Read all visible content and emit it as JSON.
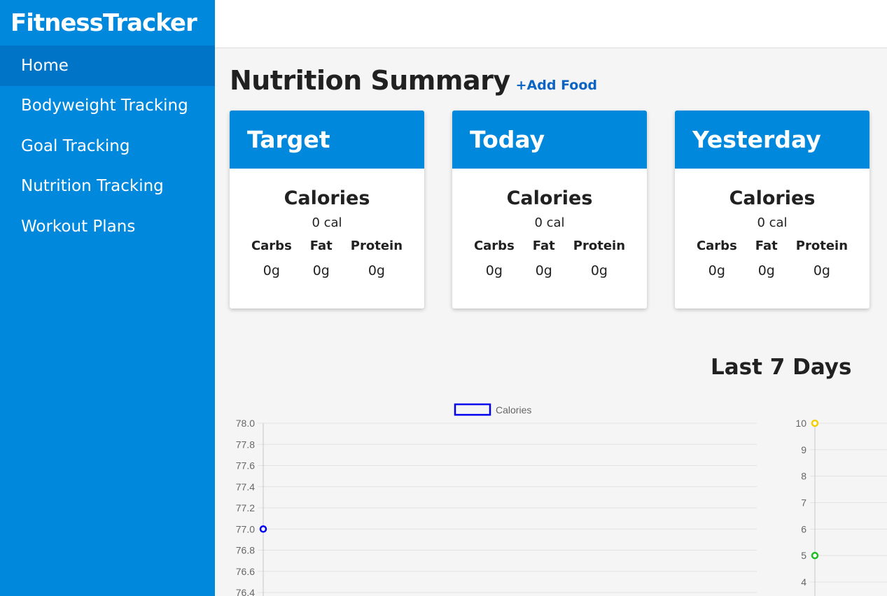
{
  "app": {
    "title": "FitnessTracker"
  },
  "sidebar": {
    "items": [
      {
        "label": "Home",
        "active": true
      },
      {
        "label": "Bodyweight Tracking",
        "active": false
      },
      {
        "label": "Goal Tracking",
        "active": false
      },
      {
        "label": "Nutrition Tracking",
        "active": false
      },
      {
        "label": "Workout Plans",
        "active": false
      }
    ]
  },
  "main": {
    "title": "Nutrition Summary",
    "add_food_label": "+Add Food",
    "cards": [
      {
        "title": "Target",
        "calories_label": "Calories",
        "calories_value": "0 cal",
        "carbs_label": "Carbs",
        "fat_label": "Fat",
        "protein_label": "Protein",
        "carbs": "0g",
        "fat": "0g",
        "protein": "0g"
      },
      {
        "title": "Today",
        "calories_label": "Calories",
        "calories_value": "0 cal",
        "carbs_label": "Carbs",
        "fat_label": "Fat",
        "protein_label": "Protein",
        "carbs": "0g",
        "fat": "0g",
        "protein": "0g"
      },
      {
        "title": "Yesterday",
        "calories_label": "Calories",
        "calories_value": "0 cal",
        "carbs_label": "Carbs",
        "fat_label": "Fat",
        "protein_label": "Protein",
        "carbs": "0g",
        "fat": "0g",
        "protein": "0g"
      }
    ],
    "section_title": "Last 7 Days"
  },
  "colors": {
    "sidebar": "#0088dd",
    "sidebar_active": "#0074c6",
    "link": "#0b63c4",
    "calories_series": "#0000ee"
  },
  "chart_data": [
    {
      "type": "line",
      "legend": [
        {
          "name": "Calories",
          "color": "#0000ee"
        }
      ],
      "legend_position": "top",
      "ylim": [
        76.4,
        78.0
      ],
      "y_ticks": [
        "78.0",
        "77.8",
        "77.6",
        "77.4",
        "77.2",
        "77.0",
        "76.8",
        "76.6",
        "76.4"
      ],
      "series": [
        {
          "name": "Calories",
          "color": "#0000ee",
          "points": [
            {
              "x": 0,
              "y": 77.0
            }
          ]
        }
      ],
      "grid": true
    },
    {
      "type": "line",
      "ylim": [
        4,
        10
      ],
      "y_ticks": [
        "10",
        "9",
        "8",
        "7",
        "6",
        "5",
        "4"
      ],
      "series": [
        {
          "color": "#f0d000",
          "points": [
            {
              "x": 0,
              "y": 10
            }
          ]
        },
        {
          "color": "#22bb22",
          "points": [
            {
              "x": 0,
              "y": 5
            }
          ]
        }
      ],
      "grid": true
    }
  ]
}
